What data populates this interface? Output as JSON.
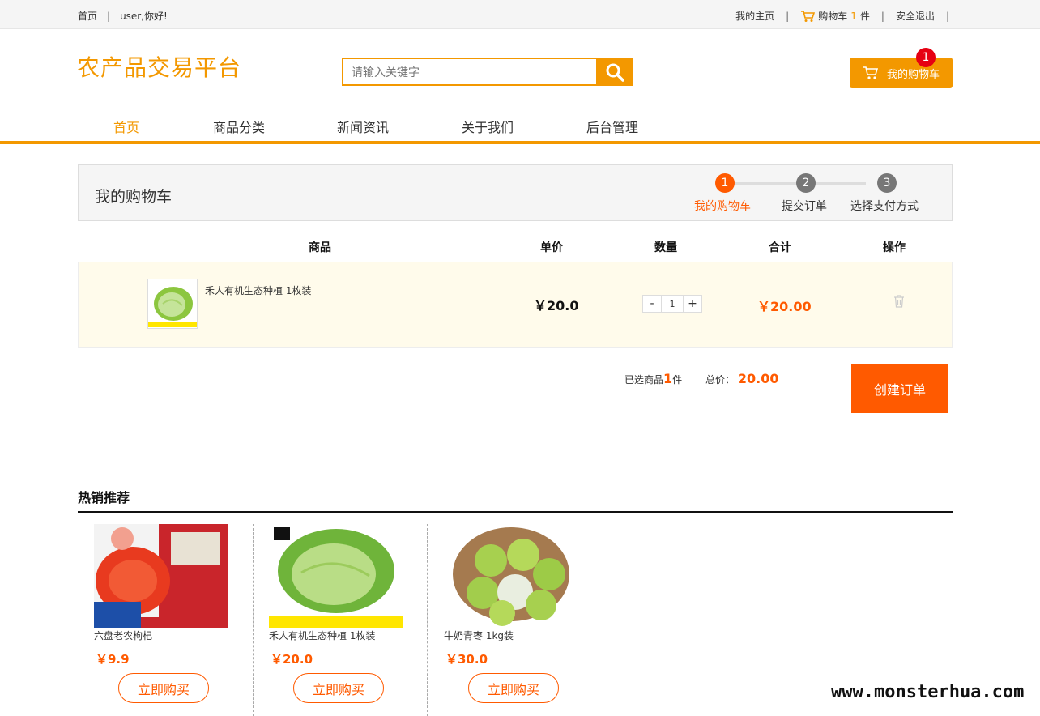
{
  "topbar": {
    "home": "首页",
    "greeting": "user,你好!",
    "my_home": "我的主页",
    "cart_prefix": "购物车",
    "cart_count": "1",
    "cart_suffix": "件",
    "logout": "安全退出"
  },
  "header": {
    "logo": "农产品交易平台",
    "search_placeholder": "请输入关键字",
    "cart_button": "我的购物车",
    "cart_badge": "1"
  },
  "nav": [
    "首页",
    "商品分类",
    "新闻资讯",
    "关于我们",
    "后台管理"
  ],
  "cart_panel": {
    "title": "我的购物车",
    "steps": [
      {
        "num": "1",
        "label": "我的购物车"
      },
      {
        "num": "2",
        "label": "提交订单"
      },
      {
        "num": "3",
        "label": "选择支付方式"
      }
    ]
  },
  "table": {
    "headers": [
      "商品",
      "单价",
      "数量",
      "合计",
      "操作"
    ],
    "rows": [
      {
        "name": "禾人有机生态种植 1枚装",
        "unit_price": "￥20.0",
        "qty": "1",
        "minus": "-",
        "plus": "+",
        "total": "￥20.00"
      }
    ]
  },
  "summary": {
    "selected_prefix": "已选商品",
    "selected_count": "1",
    "selected_suffix": "件",
    "total_label": "总价：",
    "total_value": "20.00",
    "create_order": "创建订单"
  },
  "hot": {
    "title": "热销推荐",
    "items": [
      {
        "name": "六盘老农枸杞",
        "price": "￥9.9",
        "buy": "立即购买"
      },
      {
        "name": "禾人有机生态种植 1枚装",
        "price": "￥20.0",
        "buy": "立即购买"
      },
      {
        "name": "牛奶青枣 1kg装",
        "price": "￥30.0",
        "buy": "立即购买"
      }
    ]
  },
  "watermark": "www.monsterhua.com",
  "colors": {
    "accent": "#f39800",
    "price": "#ff5a00",
    "badge": "#e60012"
  }
}
